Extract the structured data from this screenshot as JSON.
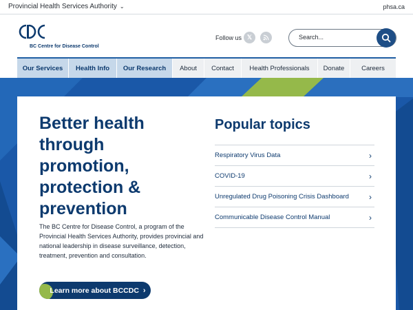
{
  "topbar": {
    "org_label": "Provincial Health Services Authority",
    "site_link": "phsa.ca"
  },
  "header": {
    "logo_text": "BC Centre for Disease Control",
    "follow_label": "Follow us",
    "social_icons": [
      "x-icon",
      "rss-icon"
    ],
    "search_placeholder": "Search..."
  },
  "nav": {
    "items": [
      {
        "label": "Our Services"
      },
      {
        "label": "Health Info"
      },
      {
        "label": "Our Research"
      },
      {
        "label": "About"
      },
      {
        "label": "Contact"
      },
      {
        "label": "Health Professionals"
      },
      {
        "label": "Donate"
      },
      {
        "label": "Careers"
      }
    ]
  },
  "hero": {
    "headline_lines": [
      "Better health",
      "through",
      "promotion,",
      "protection &",
      "prevention"
    ],
    "description": "The BC Centre for Disease Control, a program of the Provincial Health Services Authority, provides provincial and national leadership in disease surveillance, detection, treatment, prevention and consultation.",
    "cta_label": "Learn more about BCCDC"
  },
  "popular": {
    "title": "Popular topics",
    "items": [
      {
        "label": "Respiratory Virus Data"
      },
      {
        "label": "COVID-19"
      },
      {
        "label": "Unregulated Drug Poisoning Crisis Dashboard"
      },
      {
        "label": "Communicable Disease Control Manual"
      }
    ]
  },
  "colors": {
    "brand_navy": "#0d3a6e",
    "brand_blue": "#1a58a8",
    "accent_green": "#95b94a",
    "nav_highlight": "#c6d8ea"
  }
}
